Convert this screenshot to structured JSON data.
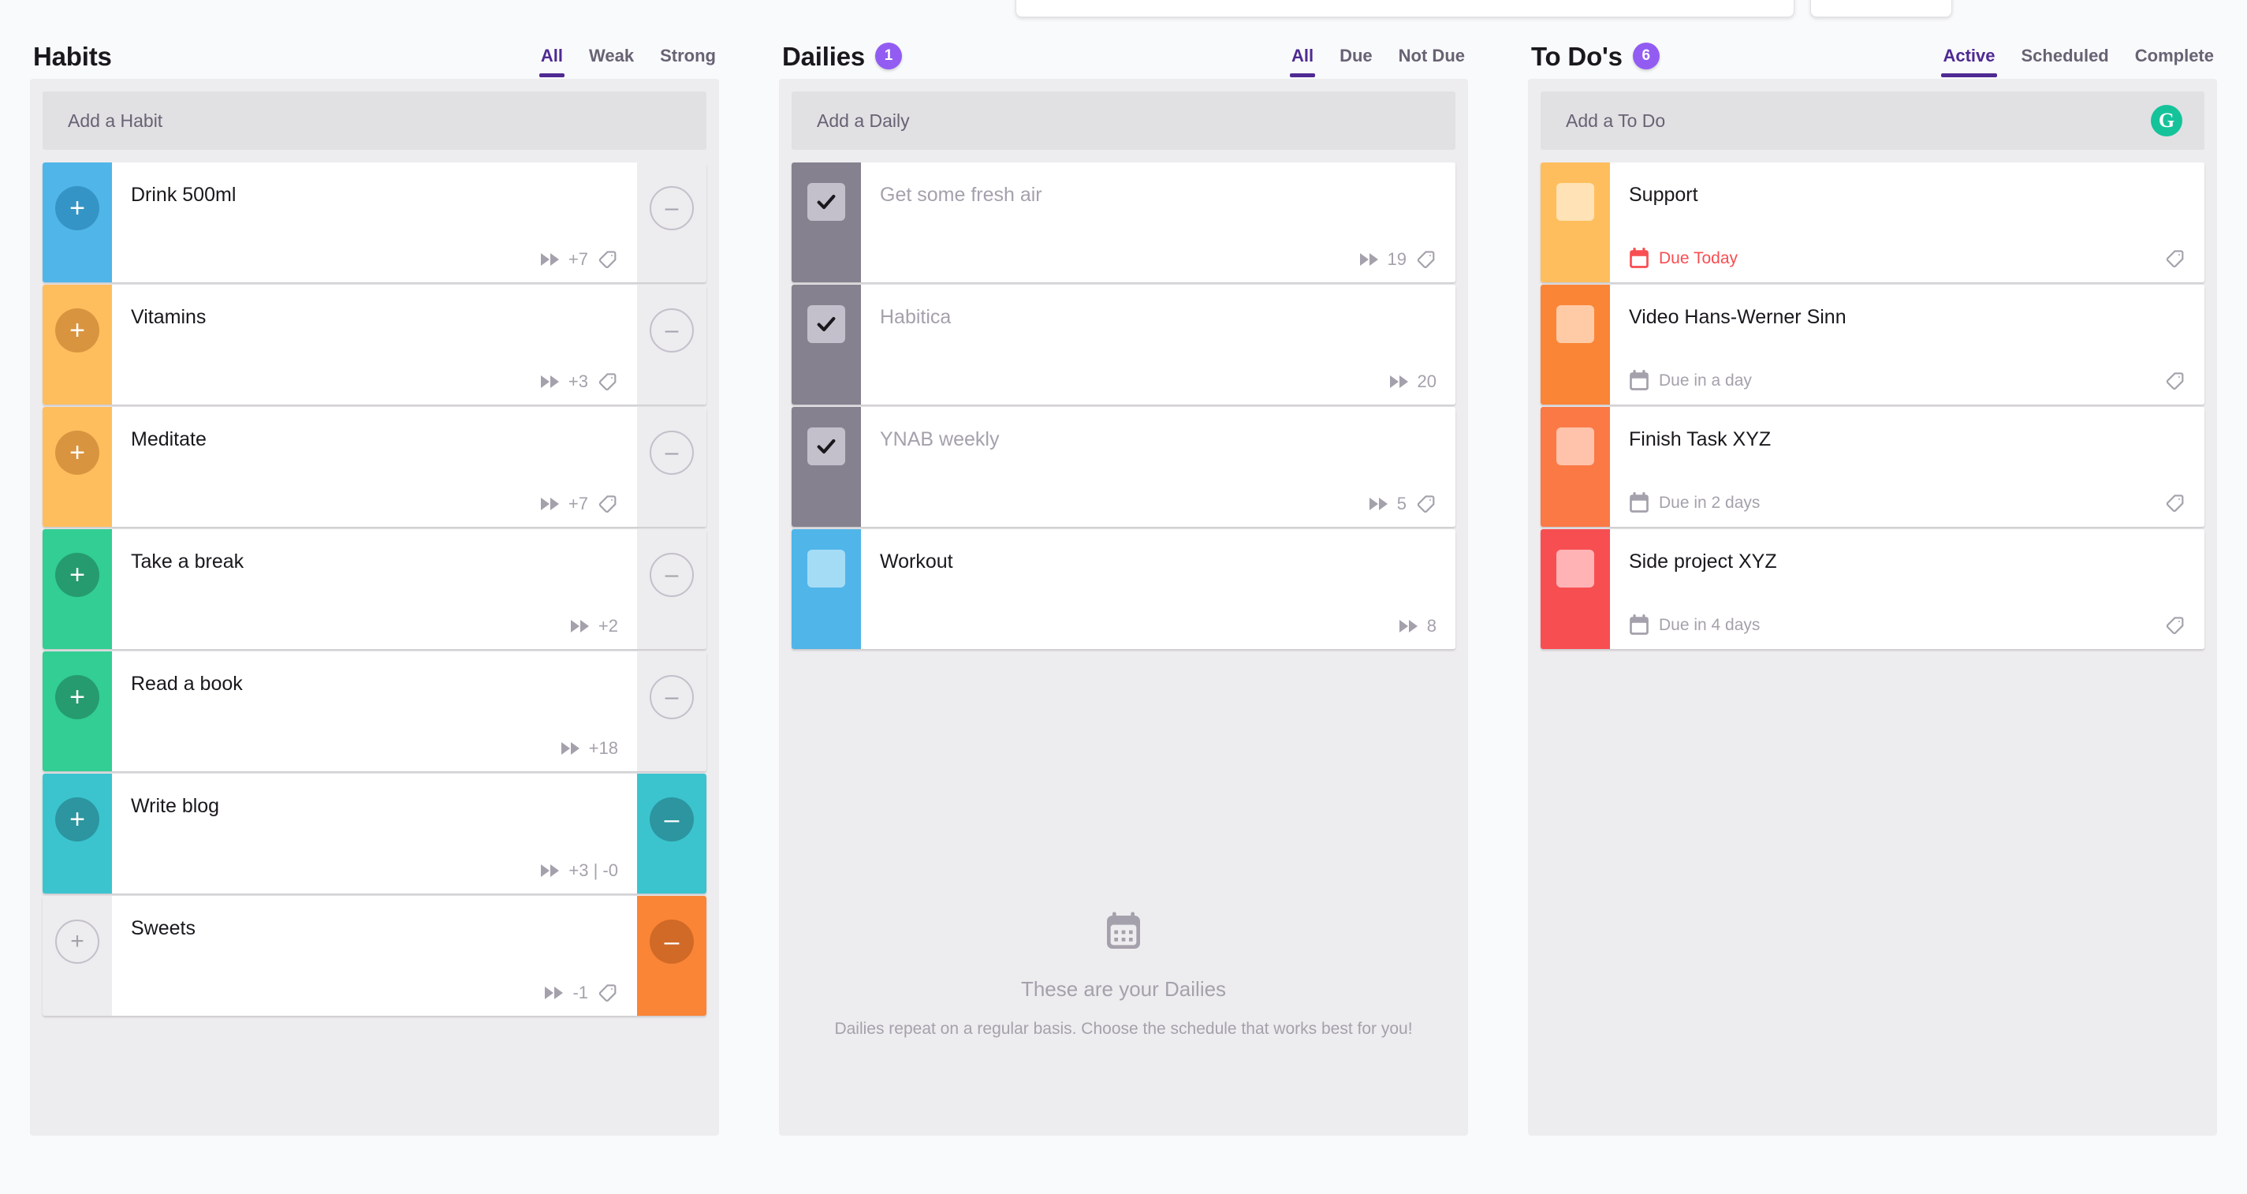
{
  "colors": {
    "purple": "#925CF3",
    "purple_dark": "#4F2A93",
    "blue": "#50B5E9",
    "blue_dark": "#3594C6",
    "orange_light": "#FFBE5D",
    "orange_light_dark": "#D9943F",
    "green": "#32CE94",
    "green_dark": "#269B6F",
    "teal": "#3BC4CE",
    "teal_dark": "#2C95A0",
    "orange": "#FA8537",
    "orange_dark": "#D06A26",
    "red": "#F74E52",
    "grey_disabled": "#EDECEE",
    "daily_done_bar": "#86818F",
    "daily_done_chk": "#C3C0CB",
    "todo_orange_chk": "#FFD9A3",
    "grammarly_green": "#15C39A"
  },
  "habits": {
    "title": "Habits",
    "add_placeholder": "Add a Habit",
    "tabs": [
      {
        "label": "All",
        "active": true
      },
      {
        "label": "Weak",
        "active": false
      },
      {
        "label": "Strong",
        "active": false
      }
    ],
    "items": [
      {
        "title": "Drink 500ml",
        "counter": "+7",
        "color": "blue",
        "color_dark": "blue_dark",
        "plus_enabled": true,
        "minus_enabled": false,
        "has_tag": true
      },
      {
        "title": "Vitamins",
        "counter": "+3",
        "color": "orange_light",
        "color_dark": "orange_light_dark",
        "plus_enabled": true,
        "minus_enabled": false,
        "has_tag": true
      },
      {
        "title": "Meditate",
        "counter": "+7",
        "color": "orange_light",
        "color_dark": "orange_light_dark",
        "plus_enabled": true,
        "minus_enabled": false,
        "has_tag": true
      },
      {
        "title": "Take a break",
        "counter": "+2",
        "color": "green",
        "color_dark": "green_dark",
        "plus_enabled": true,
        "minus_enabled": false,
        "has_tag": false
      },
      {
        "title": "Read a book",
        "counter": "+18",
        "color": "green",
        "color_dark": "green_dark",
        "plus_enabled": true,
        "minus_enabled": false,
        "has_tag": false
      },
      {
        "title": "Write blog",
        "counter": "+3 | -0",
        "color": "teal",
        "color_dark": "teal_dark",
        "plus_enabled": true,
        "minus_enabled": true,
        "has_tag": false
      },
      {
        "title": "Sweets",
        "counter": "-1",
        "color": "orange",
        "color_dark": "orange_dark",
        "plus_enabled": false,
        "minus_enabled": true,
        "has_tag": true
      }
    ]
  },
  "dailies": {
    "title": "Dailies",
    "badge": "1",
    "add_placeholder": "Add a Daily",
    "tabs": [
      {
        "label": "All",
        "active": true
      },
      {
        "label": "Due",
        "active": false
      },
      {
        "label": "Not Due",
        "active": false
      }
    ],
    "items": [
      {
        "title": "Get some fresh air",
        "streak": "19",
        "done": true,
        "color": "daily_done_bar",
        "has_tag": true
      },
      {
        "title": "Habitica",
        "streak": "20",
        "done": true,
        "color": "daily_done_bar",
        "has_tag": false
      },
      {
        "title": "YNAB weekly",
        "streak": "5",
        "done": true,
        "color": "daily_done_bar",
        "has_tag": true
      },
      {
        "title": "Workout",
        "streak": "8",
        "done": false,
        "color": "blue",
        "has_tag": false
      }
    ],
    "empty_title": "These are your Dailies",
    "empty_sub": "Dailies repeat on a regular basis. Choose the schedule that works best for you!"
  },
  "todos": {
    "title": "To Do's",
    "badge": "6",
    "add_placeholder": "Add a To Do",
    "grammarly_label": "G",
    "tabs": [
      {
        "label": "Active",
        "active": true
      },
      {
        "label": "Scheduled",
        "active": false
      },
      {
        "label": "Complete",
        "active": false
      }
    ],
    "items": [
      {
        "title": "Support",
        "due": "Due Today",
        "urgent": true,
        "bar": "#FFBE5D",
        "chk": "#FFE2B5",
        "has_tag": true
      },
      {
        "title": "Video Hans-Werner Sinn",
        "due": "Due in a day",
        "urgent": false,
        "bar": "#FA8537",
        "chk": "#FFCBA6",
        "has_tag": true
      },
      {
        "title": "Finish Task XYZ",
        "due": "Due in 2 days",
        "urgent": false,
        "bar": "#FA7945",
        "chk": "#FFC2AB",
        "has_tag": true
      },
      {
        "title": "Side project XYZ",
        "due": "Due in 4 days",
        "urgent": false,
        "bar": "#F74E52",
        "chk": "#FFB3B5",
        "has_tag": true
      }
    ]
  }
}
